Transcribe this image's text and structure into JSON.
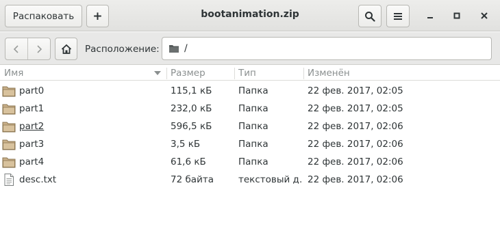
{
  "header": {
    "extract_label": "Распаковать",
    "add_label": "+",
    "title": "bootanimation.zip"
  },
  "location": {
    "label": "Расположение:",
    "path": "/"
  },
  "columns": {
    "name": "Имя",
    "size": "Размер",
    "type": "Тип",
    "modified": "Изменён"
  },
  "files": [
    {
      "name": "part0",
      "size": "115,1 кБ",
      "type": "Папка",
      "modified": "22 фев. 2017, 02:05",
      "icon": "folder-icon"
    },
    {
      "name": "part1",
      "size": "232,0 кБ",
      "type": "Папка",
      "modified": "22 фев. 2017, 02:05",
      "icon": "folder-icon"
    },
    {
      "name": "part2",
      "size": "596,5 кБ",
      "type": "Папка",
      "modified": "22 фев. 2017, 02:06",
      "icon": "folder-icon"
    },
    {
      "name": "part3",
      "size": "3,5 кБ",
      "type": "Папка",
      "modified": "22 фев. 2017, 02:06",
      "icon": "folder-icon"
    },
    {
      "name": "part4",
      "size": "61,6 кБ",
      "type": "Папка",
      "modified": "22 фев. 2017, 02:06",
      "icon": "folder-icon"
    },
    {
      "name": "desc.txt",
      "size": "72 байта",
      "type": "текстовый д…",
      "modified": "22 фев. 2017, 02:06",
      "icon": "text-file-icon"
    }
  ],
  "colors": {
    "folder_fill": "#c9b08a",
    "folder_stroke": "#8a744f",
    "header_text": "#8a8f8f"
  }
}
